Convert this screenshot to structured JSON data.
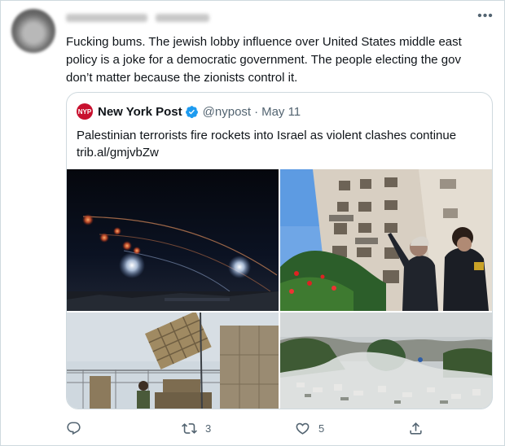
{
  "tweet": {
    "text": "Fucking bums. The jewish lobby influence over United States middle east policy is a joke for a democratic government. The people electing the gov don’t matter because the zionists control it.",
    "more_icon": "ellipsis-icon"
  },
  "quote": {
    "logo_text": "NYP",
    "name": "New York Post",
    "handle": "@nypost",
    "separator": "·",
    "date": "May 11",
    "text_line1": "Palestinian terrorists fire rockets into Israel as violent clashes continue",
    "text_line2": "trib.al/gmjvbZw",
    "verified_color": "#1d9bf0",
    "brand_color": "#c8102e"
  },
  "actions": {
    "reply_icon": "reply-icon",
    "retweet_icon": "retweet-icon",
    "retweet_count": "3",
    "like_icon": "heart-icon",
    "like_count": "5",
    "share_icon": "share-icon"
  }
}
